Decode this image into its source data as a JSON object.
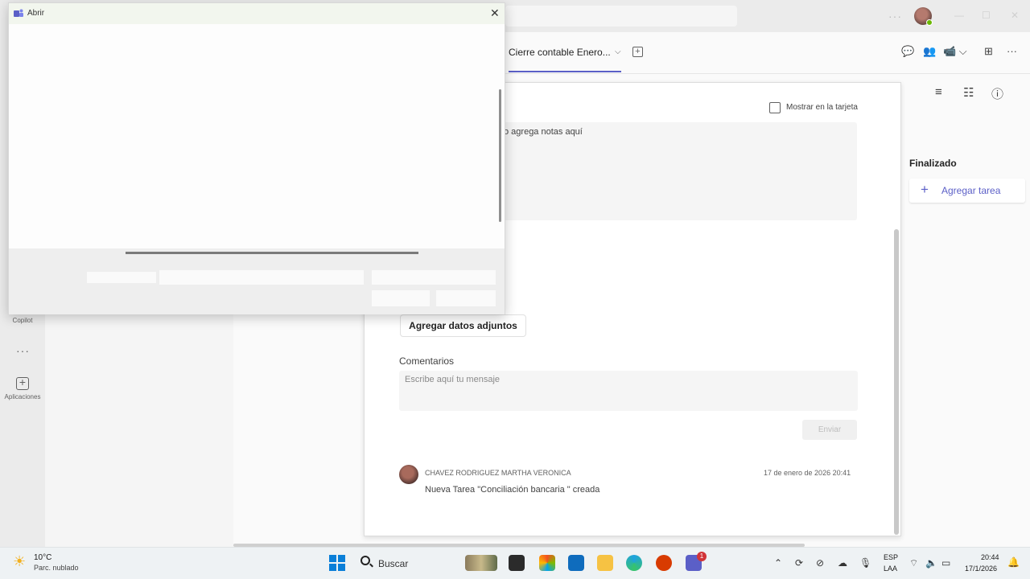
{
  "dialog": {
    "title": "Abrir",
    "close_glyph": "✕",
    "loading_progress": 1.0
  },
  "teams_header": {
    "tab_title": "Cierre contable Enero...",
    "more_glyph": "···"
  },
  "board": {
    "column_title": "Finalizado",
    "add_task_label": "Agregar tarea"
  },
  "task": {
    "show_on_card_label": "Mostrar en la tarjeta",
    "notes_text": "o agrega notas aquí",
    "attach_button_label": "Agregar datos adjuntos",
    "comments_label": "Comentarios",
    "comment_placeholder": "Escribe aquí tu mensaje",
    "send_button_label": "Enviar",
    "activity": {
      "user": "CHAVEZ RODRIGUEZ MARTHA VERONICA",
      "date": "17 de enero de 2026 20:41",
      "text": "Nueva Tarea \"Conciliación bancaria \" creada"
    }
  },
  "rail": {
    "copilot_label": "Copilot",
    "apps_label": "Aplicaciones"
  },
  "taskbar": {
    "weather_temp": "10°C",
    "weather_desc": "Parc. nublado",
    "search_label": "Buscar",
    "lang_top": "ESP",
    "lang_bottom": "LAA",
    "time": "20:44",
    "date": "17/1/2026",
    "notification_count": "1"
  },
  "colors": {
    "accent": "#5b5fc7",
    "windows_blue": "#0a7fd8",
    "badge_red": "#d13438"
  }
}
